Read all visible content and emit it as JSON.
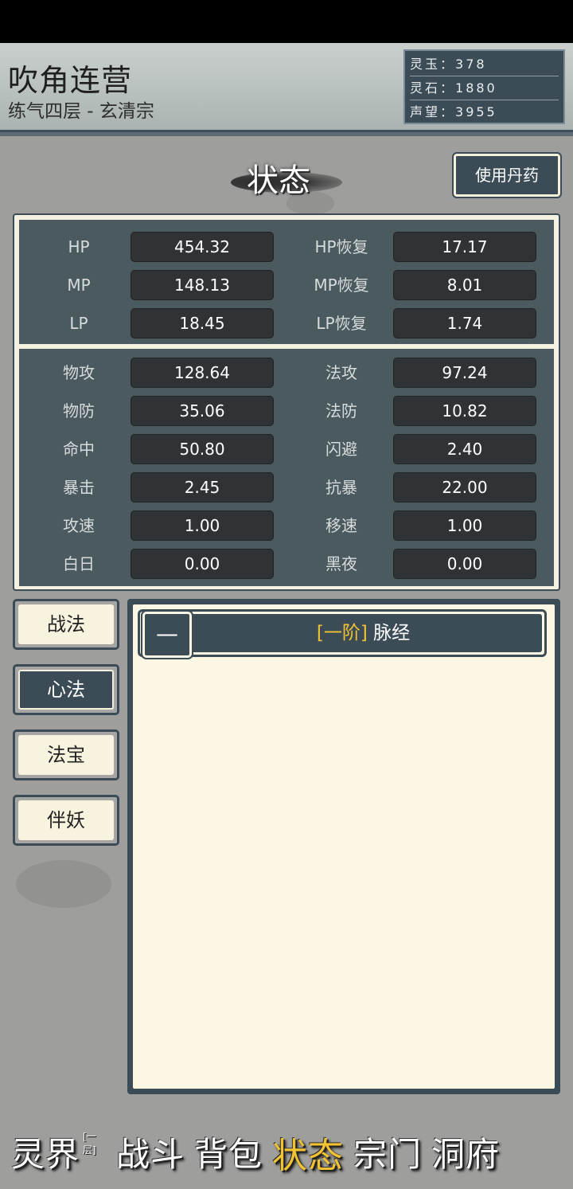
{
  "header": {
    "player_name": "吹角连营",
    "player_rank": "练气四层 - 玄清宗",
    "currency": [
      {
        "label": "灵玉：",
        "value": "378"
      },
      {
        "label": "灵石：",
        "value": "1880"
      },
      {
        "label": "声望：",
        "value": "3955"
      }
    ]
  },
  "page": {
    "title": "状态",
    "potion_button": "使用丹药"
  },
  "stats_top": [
    {
      "label_l": "HP",
      "value_l": "454.32",
      "label_r": "HP恢复",
      "value_r": "17.17"
    },
    {
      "label_l": "MP",
      "value_l": "148.13",
      "label_r": "MP恢复",
      "value_r": "8.01"
    },
    {
      "label_l": "LP",
      "value_l": "18.45",
      "label_r": "LP恢复",
      "value_r": "1.74"
    }
  ],
  "stats_bottom": [
    {
      "label_l": "物攻",
      "value_l": "128.64",
      "label_r": "法攻",
      "value_r": "97.24"
    },
    {
      "label_l": "物防",
      "value_l": "35.06",
      "label_r": "法防",
      "value_r": "10.82"
    },
    {
      "label_l": "命中",
      "value_l": "50.80",
      "label_r": "闪避",
      "value_r": "2.40"
    },
    {
      "label_l": "暴击",
      "value_l": "2.45",
      "label_r": "抗暴",
      "value_r": "22.00"
    },
    {
      "label_l": "攻速",
      "value_l": "1.00",
      "label_r": "移速",
      "value_r": "1.00"
    },
    {
      "label_l": "白日",
      "value_l": "0.00",
      "label_r": "黑夜",
      "value_r": "0.00"
    }
  ],
  "side_tabs": [
    "战法",
    "心法",
    "法宝",
    "伴妖"
  ],
  "skill": {
    "collapse": "—",
    "tier": "[一阶]",
    "name": "脉经"
  },
  "bottom_nav": {
    "items": [
      "灵界",
      "战斗",
      "背包",
      "状态",
      "宗门",
      "洞府"
    ],
    "badge": "[一层]"
  },
  "colors": {
    "panel_dark": "#3b4c57",
    "cream": "#f8f3df",
    "gold_accent": "#f1c232"
  }
}
